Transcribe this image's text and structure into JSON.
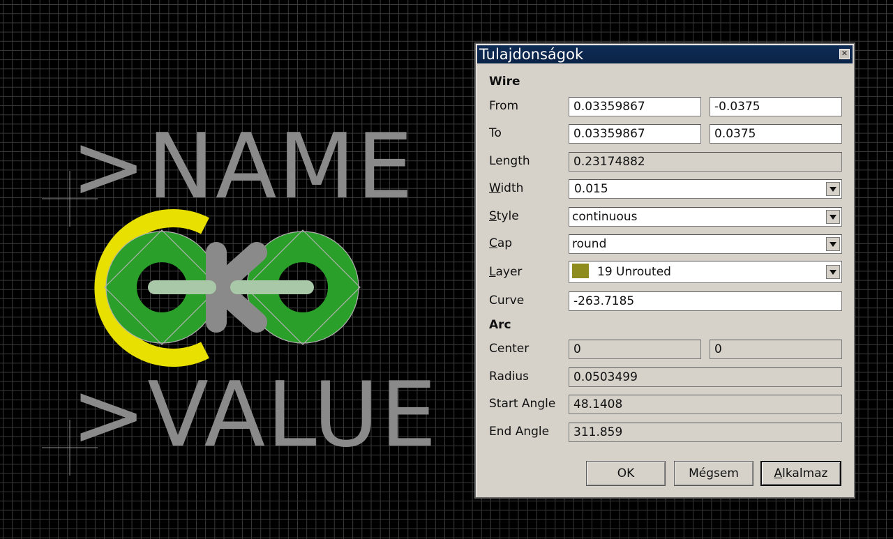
{
  "canvas": {
    "name_text": ">NAME",
    "value_text": ">VALUE",
    "colors": {
      "background": "#000000",
      "grid": "#3a3a3a",
      "text_layer": "#8a8a8a",
      "pad_green": "#2aa02a",
      "outline_yellow": "#e8e000"
    }
  },
  "dialog": {
    "title": "Tulajdonságok",
    "wire": {
      "heading": "Wire",
      "from_label": "From",
      "from_x": "0.03359867",
      "from_y": "-0.0375",
      "to_label": "To",
      "to_x": "0.03359867",
      "to_y": "0.0375",
      "length_label": "Length",
      "length_value": "0.23174882",
      "width_label": "Width",
      "width_value": "0.015",
      "style_label": "Style",
      "style_value": "continuous",
      "cap_label": "Cap",
      "cap_value": "round",
      "layer_label": "Layer",
      "layer_value": "19 Unrouted",
      "layer_color": "#8e8c1e",
      "curve_label": "Curve",
      "curve_value": "-263.7185"
    },
    "arc": {
      "heading": "Arc",
      "center_label": "Center",
      "center_x": "0",
      "center_y": "0",
      "radius_label": "Radius",
      "radius_value": "0.0503499",
      "start_label": "Start Angle",
      "start_value": "48.1408",
      "end_label": "End Angle",
      "end_value": "311.859"
    },
    "buttons": {
      "ok": "OK",
      "cancel": "Mégsem",
      "apply": "Alkalmaz"
    }
  }
}
